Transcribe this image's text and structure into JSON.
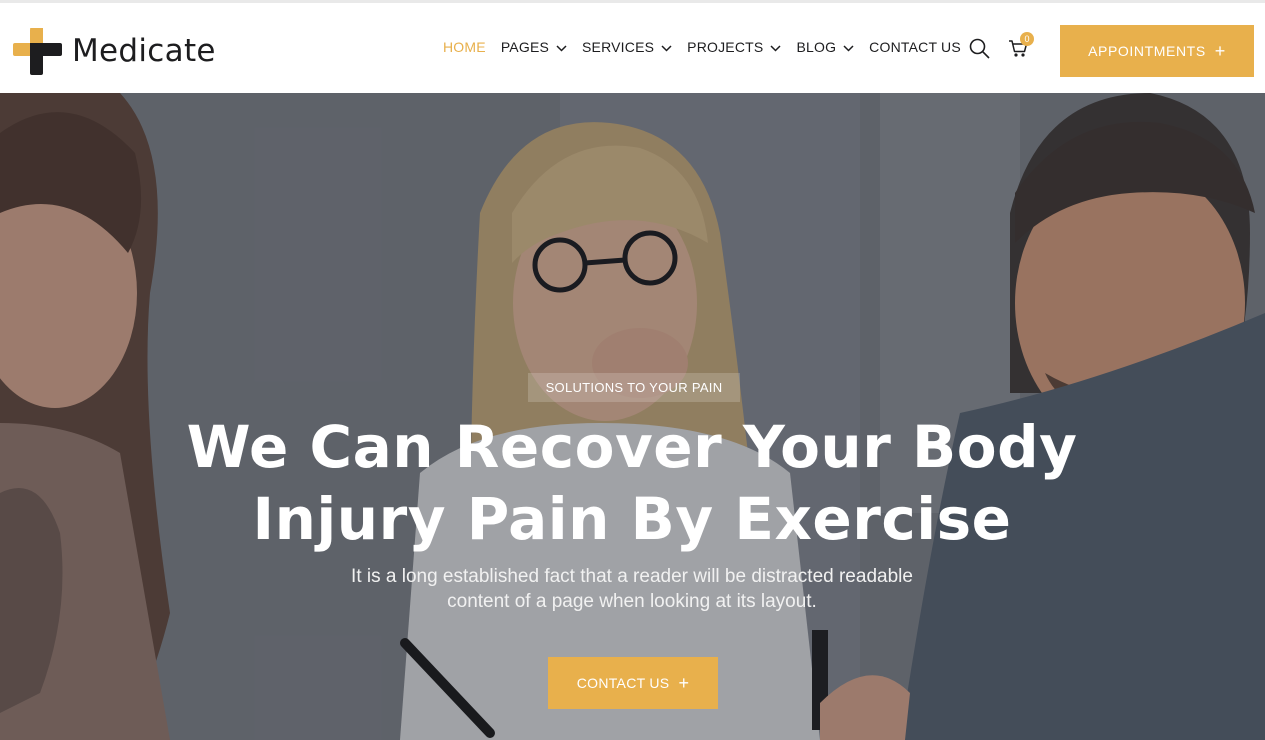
{
  "brand": {
    "name": "Medicate",
    "accent": "#e8b04c",
    "dark": "#1d1d1f",
    "logo_icon": "medical-cross-icon"
  },
  "nav": {
    "items": [
      {
        "label": "HOME",
        "active": true,
        "dropdown": false
      },
      {
        "label": "PAGES",
        "active": false,
        "dropdown": true
      },
      {
        "label": "SERVICES",
        "active": false,
        "dropdown": true
      },
      {
        "label": "PROJECTS",
        "active": false,
        "dropdown": true
      },
      {
        "label": "BLOG",
        "active": false,
        "dropdown": true
      },
      {
        "label": "CONTACT US",
        "active": false,
        "dropdown": false
      }
    ]
  },
  "header": {
    "search_icon": "search-icon",
    "cart_icon": "cart-icon",
    "cart_count": "0",
    "appointments_label": "APPOINTMENTS",
    "plus": "+"
  },
  "hero": {
    "tag": "SOLUTIONS TO YOUR PAIN",
    "title_line1": "We Can Recover Your Body",
    "title_line2": "Injury Pain By Exercise",
    "subtitle_line1": "It is a long established fact that a reader will be distracted readable",
    "subtitle_line2": "content of a page when looking at its layout.",
    "cta_label": "CONTACT US",
    "cta_plus": "+"
  }
}
